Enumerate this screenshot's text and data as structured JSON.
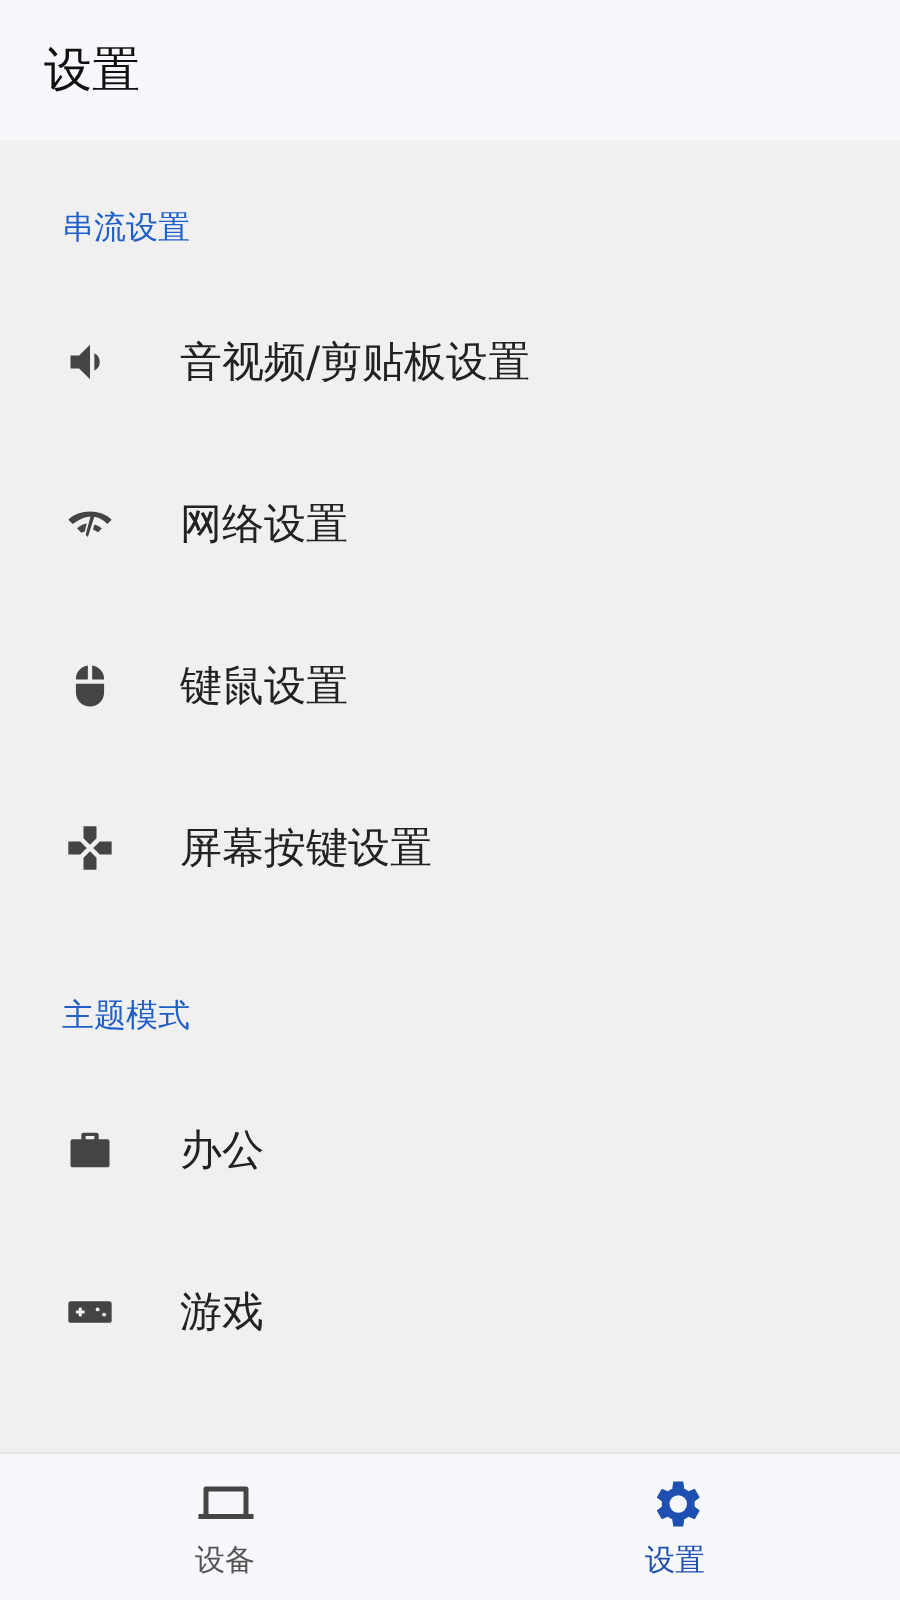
{
  "app_bar": {
    "title": "设置"
  },
  "sections": [
    {
      "header": "串流设置",
      "items": [
        {
          "label": "音视频/剪贴板设置"
        },
        {
          "label": "网络设置"
        },
        {
          "label": "键鼠设置"
        },
        {
          "label": "屏幕按键设置"
        }
      ]
    },
    {
      "header": "主题模式",
      "items": [
        {
          "label": "办公"
        },
        {
          "label": "游戏"
        }
      ]
    }
  ],
  "bottom_nav": [
    {
      "label": "设备",
      "selected": false
    },
    {
      "label": "设置",
      "selected": true
    }
  ]
}
